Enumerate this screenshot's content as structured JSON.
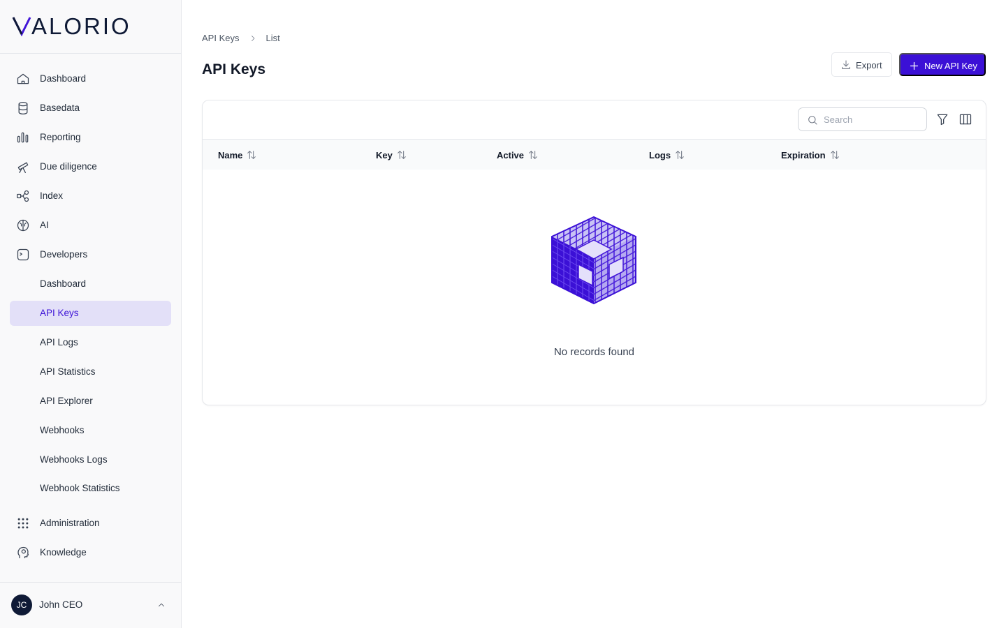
{
  "app": {
    "logo_text": "VALORIO"
  },
  "nav": {
    "items": [
      {
        "label": "Dashboard",
        "icon": "home-icon"
      },
      {
        "label": "Basedata",
        "icon": "database-icon"
      },
      {
        "label": "Reporting",
        "icon": "bar-chart-icon"
      },
      {
        "label": "Due diligence",
        "icon": "telescope-icon"
      },
      {
        "label": "Index",
        "icon": "network-icon"
      },
      {
        "label": "AI",
        "icon": "brain-icon"
      },
      {
        "label": "Developers",
        "icon": "terminal-icon"
      }
    ],
    "developer_sub": [
      {
        "label": "Dashboard"
      },
      {
        "label": "API Keys",
        "active": true
      },
      {
        "label": "API Logs"
      },
      {
        "label": "API Statistics"
      },
      {
        "label": "API Explorer"
      },
      {
        "label": "Webhooks"
      },
      {
        "label": "Webhooks Logs"
      },
      {
        "label": "Webhook Statistics"
      }
    ],
    "bottom_items": [
      {
        "label": "Administration",
        "icon": "grid-dots-icon"
      },
      {
        "label": "Knowledge",
        "icon": "head-icon"
      }
    ]
  },
  "user": {
    "initials": "JC",
    "name": "John CEO"
  },
  "breadcrumb": {
    "first": "API Keys",
    "second": "List"
  },
  "page": {
    "title": "API Keys"
  },
  "actions": {
    "export_label": "Export",
    "new_label": "New API Key"
  },
  "table": {
    "search_placeholder": "Search",
    "columns": [
      "Name",
      "Key",
      "Active",
      "Logs",
      "Expiration"
    ],
    "rows": [],
    "empty_text": "No records found"
  },
  "colors": {
    "accent": "#3b10d6",
    "active_bg": "#e3e0f8",
    "logo_dark": "#0f1a36"
  }
}
